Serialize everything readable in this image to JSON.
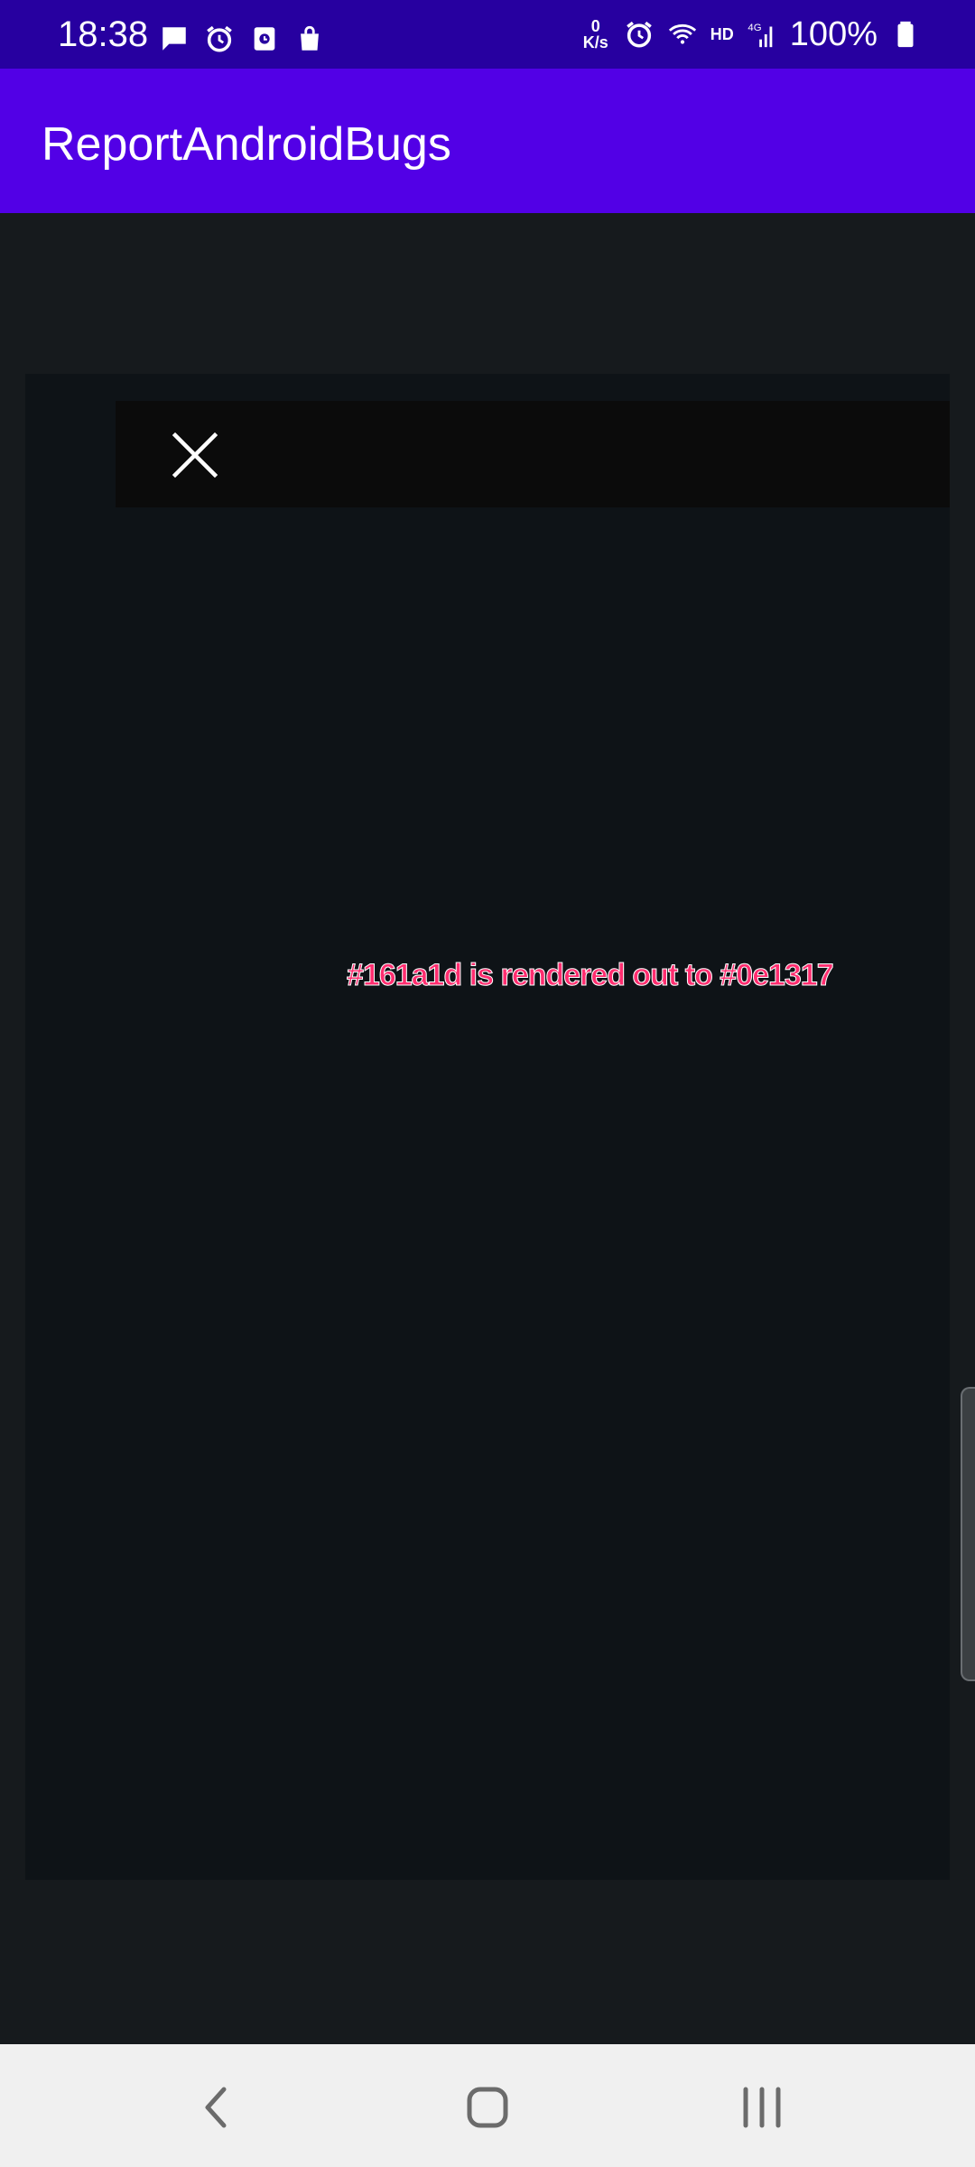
{
  "status_bar": {
    "time": "18:38",
    "notification_icons": [
      "message-icon",
      "alarm-icon",
      "calendar-icon",
      "shopping-bag-icon"
    ],
    "network_speed_value": "0",
    "network_speed_unit": "K/s",
    "hd_label": "HD",
    "network_type": "4G",
    "battery_percent": "100%"
  },
  "app_bar": {
    "title": "ReportAndroidBugs"
  },
  "main": {
    "message": "#161a1d is rendered out to #0e1317"
  },
  "colors": {
    "status_bar": "#2700a0",
    "app_bar": "#5200e6",
    "outer_background": "#161a1d",
    "inner_panel": "#0e1317",
    "toolbar": "#0b0b0b",
    "message_text": "#ff2d6f",
    "nav_bar": "#f0f0f0"
  },
  "nav_bar": {
    "icons": [
      "back-icon",
      "home-icon",
      "recents-icon"
    ]
  }
}
